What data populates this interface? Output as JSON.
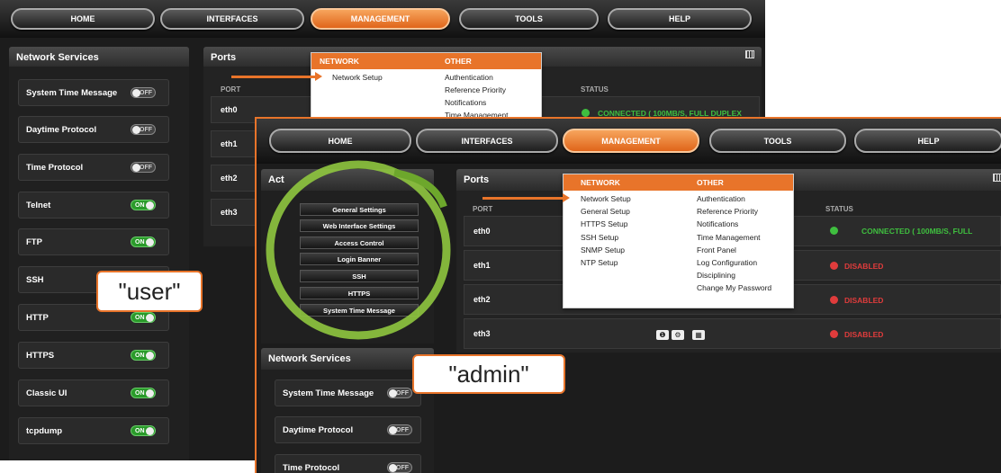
{
  "nav": [
    "HOME",
    "INTERFACES",
    "MANAGEMENT",
    "TOOLS",
    "HELP"
  ],
  "back": {
    "network_services_title": "Network Services",
    "services": [
      {
        "label": "System Time Message",
        "state": "OFF"
      },
      {
        "label": "Daytime Protocol",
        "state": "OFF"
      },
      {
        "label": "Time Protocol",
        "state": "OFF"
      },
      {
        "label": "Telnet",
        "state": "ON"
      },
      {
        "label": "FTP",
        "state": "ON"
      },
      {
        "label": "SSH",
        "state": ""
      },
      {
        "label": "HTTP",
        "state": "ON"
      },
      {
        "label": "HTTPS",
        "state": "ON"
      },
      {
        "label": "Classic UI",
        "state": "ON"
      },
      {
        "label": "tcpdump",
        "state": "ON"
      }
    ],
    "ports_title": "Ports",
    "port_header": "PORT",
    "status_header": "STATUS",
    "ports": [
      "eth0",
      "eth1",
      "eth2",
      "eth3"
    ],
    "eth0_status": "CONNECTED ( 100MB/S, FULL DUPLEX",
    "menu": {
      "network_header": "NETWORK",
      "other_header": "OTHER",
      "network_items": [
        "Network Setup"
      ],
      "other_items": [
        "Authentication",
        "Reference Priority",
        "Notifications",
        "Time Management"
      ]
    }
  },
  "front": {
    "actions_title": "Act",
    "action_buttons": [
      "General Settings",
      "Web Interface Settings",
      "Access Control",
      "Login Banner",
      "SSH",
      "HTTPS",
      "System Time Message"
    ],
    "network_services_title": "Network Services",
    "services": [
      {
        "label": "System Time Message",
        "state": "OFF"
      },
      {
        "label": "Daytime Protocol",
        "state": "OFF"
      },
      {
        "label": "Time Protocol",
        "state": "OFF"
      }
    ],
    "ports_title": "Ports",
    "port_header": "PORT",
    "status_header": "STATUS",
    "ports": [
      {
        "name": "eth0",
        "status": "CONNECTED ( 100MB/S, FULL",
        "color": "#3fbf3f"
      },
      {
        "name": "eth1",
        "status": "DISABLED",
        "color": "#e03c3c"
      },
      {
        "name": "eth2",
        "status": "DISABLED",
        "color": "#e03c3c"
      },
      {
        "name": "eth3",
        "status": "DISABLED",
        "color": "#e03c3c"
      }
    ],
    "menu": {
      "network_header": "NETWORK",
      "other_header": "OTHER",
      "network_items": [
        "Network Setup",
        "General Setup",
        "HTTPS Setup",
        "SSH Setup",
        "SNMP Setup",
        "NTP Setup"
      ],
      "other_items": [
        "Authentication",
        "Reference Priority",
        "Notifications",
        "Time Management",
        "Front Panel",
        "Log Configuration",
        "Disciplining",
        "Change My Password"
      ]
    }
  },
  "callouts": {
    "user": "\"user\"",
    "admin": "\"admin\""
  },
  "colors": {
    "accent": "#e8742a",
    "ring": "#8fc63f",
    "on": "#2a9a2a",
    "connected": "#3fbf3f",
    "disabled": "#e03c3c"
  }
}
